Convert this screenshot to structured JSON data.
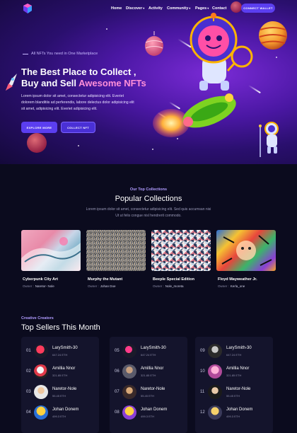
{
  "nav": {
    "items": [
      {
        "label": "Home",
        "dropdown": false
      },
      {
        "label": "Discover",
        "dropdown": true
      },
      {
        "label": "Activity",
        "dropdown": false
      },
      {
        "label": "Community",
        "dropdown": true
      },
      {
        "label": "Pages",
        "dropdown": true
      },
      {
        "label": "Contact",
        "dropdown": false
      }
    ],
    "wallet_label": "CONNECT WALLET"
  },
  "hero": {
    "tagline": "All NFTs You need in One Marketplace",
    "title_line1": "The Best Place to Collect ,",
    "title_line2_prefix": "Buy and Sell ",
    "title_accent": "Awesome NFTs",
    "description": "Lorem ipsum dolor sit amet, consectetur adipisicing elit. Everiet dolorem blanditiis ad perferendis, labore delectus dolor adipisicing elit sit amet, adipisicing elit. Everiet adipisicing elit.",
    "explore_label": "EXPLORE MORE",
    "collect_label": "COLLECT NFT"
  },
  "collections": {
    "subtitle": "Our Top Collections",
    "title": "Popular Collections",
    "description": "Lorem ipsum dolor sit amet, consectetur adipisicing elit. Sed quis accumsan nisi Ut ut felis congue nisl hendrerit commodo.",
    "owner_prefix": "Owner :",
    "items": [
      {
        "name": "Cyberpunk City Art",
        "owner": "Naretor- Nole"
      },
      {
        "name": "Murphy the Mutant",
        "owner": "Johan Doe"
      },
      {
        "name": "Beeple Special Edition",
        "owner": "Nole_moreta"
      },
      {
        "name": "Floyd Mayweather Jr.",
        "owner": "Kerla_one"
      }
    ]
  },
  "sellers": {
    "subtitle": "Creative Creators",
    "title": "Top Sellers This Month",
    "columns": [
      [
        {
          "num": "01",
          "name": "LarySmith-30",
          "eth": "647.24 ETH"
        },
        {
          "num": "02",
          "name": "Amillia Nnor",
          "eth": "321.85 ETH"
        },
        {
          "num": "03",
          "name": "Naretor-Nole",
          "eth": "55.45 ETH"
        },
        {
          "num": "04",
          "name": "Johan Donem",
          "eth": "499.3 ETH"
        }
      ],
      [
        {
          "num": "05",
          "name": "LarySmith-30",
          "eth": "647.24 ETH"
        },
        {
          "num": "06",
          "name": "Amillia Nnor",
          "eth": "321.85 ETH"
        },
        {
          "num": "07",
          "name": "Naretor-Nole",
          "eth": "55.45 ETH"
        },
        {
          "num": "08",
          "name": "Johan Donem",
          "eth": "499.3 ETH"
        }
      ],
      [
        {
          "num": "09",
          "name": "LarySmith-30",
          "eth": "647.24 ETH"
        },
        {
          "num": "10",
          "name": "Amillia Nnor",
          "eth": "321.85 ETH"
        },
        {
          "num": "11",
          "name": "Naretor-Nole",
          "eth": "55.45 ETH"
        },
        {
          "num": "12",
          "name": "Johan Donem",
          "eth": "499.3 ETH"
        }
      ]
    ]
  },
  "colors": {
    "accent": "#5b3ef0",
    "title_accent": "#ff8fd9",
    "background": "#0b0b1e",
    "panel": "#14142c"
  }
}
